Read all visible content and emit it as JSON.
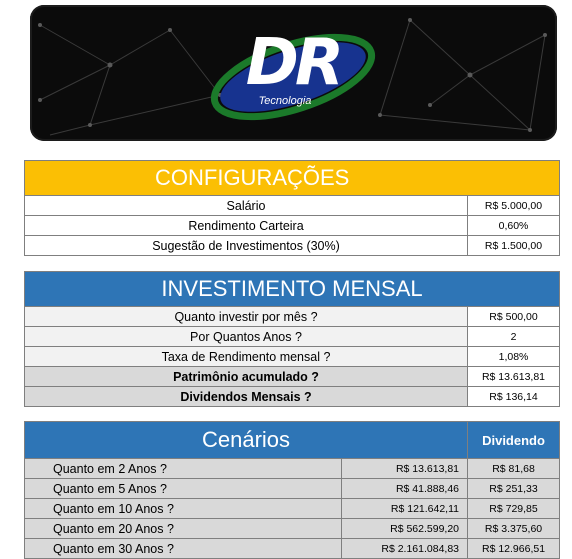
{
  "banner": {
    "logo_letters": "DR",
    "logo_subtitle": "Tecnologia"
  },
  "config": {
    "title": "CONFIGURAÇÕES",
    "rows": [
      {
        "label": "Salário",
        "value": "R$ 5.000,00"
      },
      {
        "label": "Rendimento Carteira",
        "value": "0,60%"
      },
      {
        "label": "Sugestão de Investimentos (30%)",
        "value": "R$ 1.500,00"
      }
    ]
  },
  "investimento": {
    "title": "INVESTIMENTO MENSAL",
    "rows": [
      {
        "label": "Quanto investir por mês ?",
        "value": "R$ 500,00"
      },
      {
        "label": "Por Quantos Anos ?",
        "value": "2"
      },
      {
        "label": "Taxa de Rendimento mensal ?",
        "value": "1,08%"
      },
      {
        "label": "Patrimônio acumulado ?",
        "value": "R$ 13.613,81"
      },
      {
        "label": "Dividendos Mensais ?",
        "value": "R$ 136,14"
      }
    ]
  },
  "cenarios": {
    "title": "Cenários",
    "dividend_header": "Dividendo",
    "rows": [
      {
        "label": "Quanto em 2 Anos ?",
        "value": "R$ 13.613,81",
        "dividend": "R$ 81,68"
      },
      {
        "label": "Quanto em 5 Anos ?",
        "value": "R$ 41.888,46",
        "dividend": "R$ 251,33"
      },
      {
        "label": "Quanto em 10 Anos ?",
        "value": "R$ 121.642,11",
        "dividend": "R$ 729,85"
      },
      {
        "label": "Quanto em 20 Anos ?",
        "value": "R$ 562.599,20",
        "dividend": "R$ 3.375,60"
      },
      {
        "label": "Quanto em 30 Anos ?",
        "value": "R$ 2.161.084,83",
        "dividend": "R$ 12.966,51"
      }
    ]
  },
  "colors": {
    "orange": "#fbbf04",
    "blue": "#2e75b6",
    "gray": "#d9d9d9"
  }
}
